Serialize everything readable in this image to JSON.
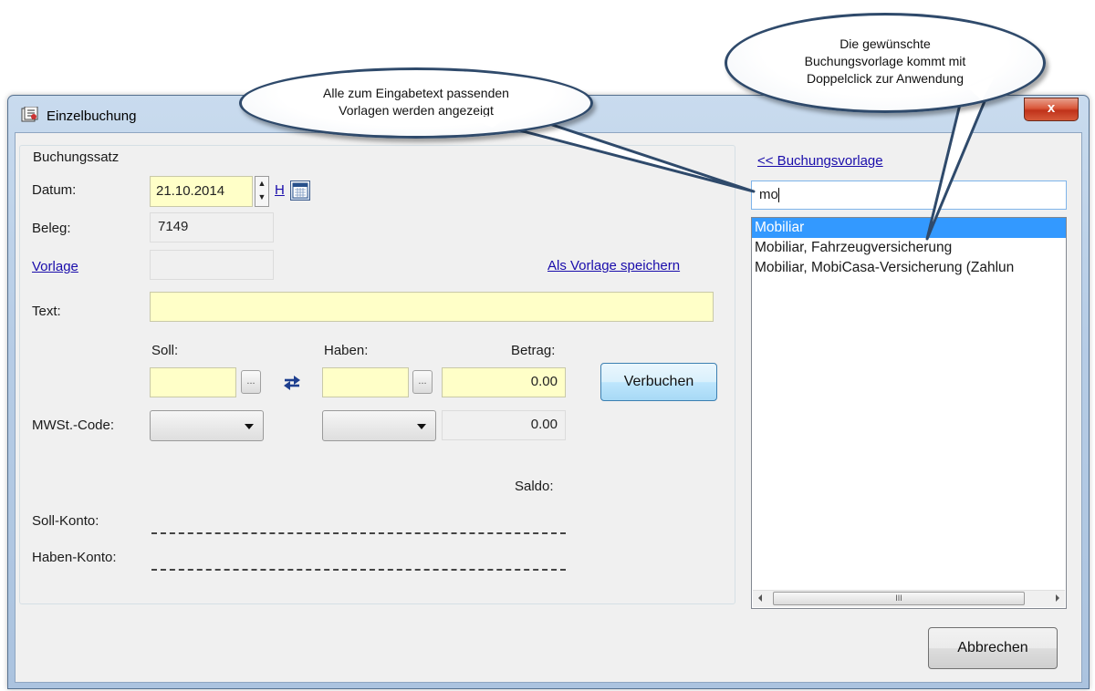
{
  "window": {
    "title": "Einzelbuchung",
    "close_label": "x"
  },
  "group": {
    "title": "Buchungssatz"
  },
  "datum": {
    "label": "Datum:",
    "value": "21.10.2014",
    "today_link": "H"
  },
  "beleg": {
    "label": "Beleg:",
    "value": "7149"
  },
  "vorlage": {
    "label": "Vorlage",
    "value": "",
    "save_link": "Als Vorlage speichern"
  },
  "text": {
    "label": "Text:",
    "value": ""
  },
  "columns": {
    "soll": "Soll:",
    "haben": "Haben:",
    "betrag": "Betrag:"
  },
  "amounts": {
    "betrag": "0.00",
    "mwst_betrag": "0.00"
  },
  "mwst": {
    "label": "MWSt.-Code:"
  },
  "buttons": {
    "verbuchen": "Verbuchen",
    "abbrechen": "Abbrechen",
    "dots": "..."
  },
  "saldo": {
    "label": "Saldo:",
    "soll_konto": "Soll-Konto:",
    "haben_konto": "Haben-Konto:"
  },
  "right_panel": {
    "link": "<< Buchungsvorlage",
    "search_value": "mo",
    "items": [
      {
        "label": "Mobiliar",
        "selected": true
      },
      {
        "label": "Mobiliar, Fahrzeugversicherung",
        "selected": false
      },
      {
        "label": "Mobiliar, MobiCasa-Versicherung (Zahlun",
        "selected": false
      }
    ],
    "scroll_grip": "III"
  },
  "callouts": {
    "left": [
      "Alle zum Eingabetext passenden",
      "Vorlagen werden angezeigt"
    ],
    "right": [
      "Die gewünschte",
      "Buchungsvorlage kommt mit",
      "Doppelclick zur Anwendung"
    ]
  },
  "colors": {
    "input_yellow": "#ffffc8",
    "selection": "#3399ff",
    "link": "#1a0dab"
  },
  "icons": {
    "swap": "swap-arrows-icon",
    "calendar": "calendar-icon",
    "app": "app-icon"
  }
}
